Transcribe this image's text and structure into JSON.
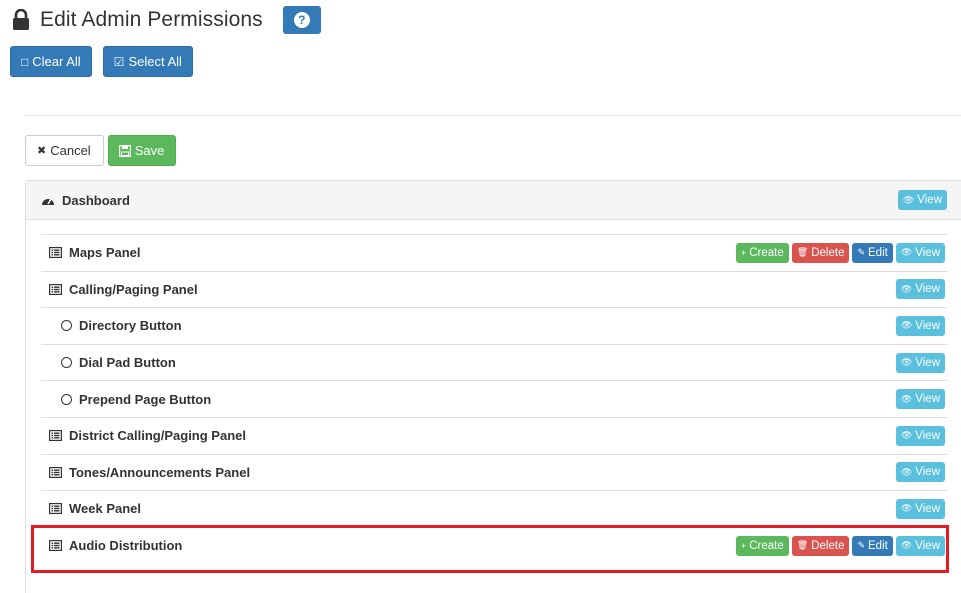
{
  "header": {
    "title": "Edit Admin Permissions",
    "lock_icon": "lock-icon",
    "help_icon": "question-icon",
    "help_glyph": "?"
  },
  "top_actions": {
    "clear_all": "Clear All",
    "select_all": "Select All",
    "clear_icon": "□",
    "select_icon": "☑"
  },
  "form_actions": {
    "cancel": "Cancel",
    "save": "Save",
    "cancel_icon": "✖",
    "save_icon": "💾"
  },
  "panel": {
    "title": "Dashboard",
    "view": "View"
  },
  "labels": {
    "create": "Create",
    "delete": "Delete",
    "edit": "Edit",
    "view": "View",
    "create_glyph": "+",
    "delete_glyph": "🗑",
    "edit_glyph": "✎",
    "view_glyph": "👁"
  },
  "rows": [
    {
      "label": "Maps Panel",
      "type": "panel"
    },
    {
      "label": "Calling/Paging Panel",
      "type": "panel"
    },
    {
      "label": "Directory Button",
      "type": "button"
    },
    {
      "label": "Dial Pad Button",
      "type": "button"
    },
    {
      "label": "Prepend Page Button",
      "type": "button"
    },
    {
      "label": "District Calling/Paging Panel",
      "type": "panel"
    },
    {
      "label": "Tones/Announcements Panel",
      "type": "panel"
    },
    {
      "label": "Week Panel",
      "type": "panel"
    },
    {
      "label": "Audio Distribution",
      "type": "panel",
      "highlighted": true
    }
  ],
  "colors": {
    "primary": "#337ab7",
    "success": "#5cb85c",
    "danger": "#d9534f",
    "info": "#5bc0de",
    "highlight": "#e31b23"
  }
}
